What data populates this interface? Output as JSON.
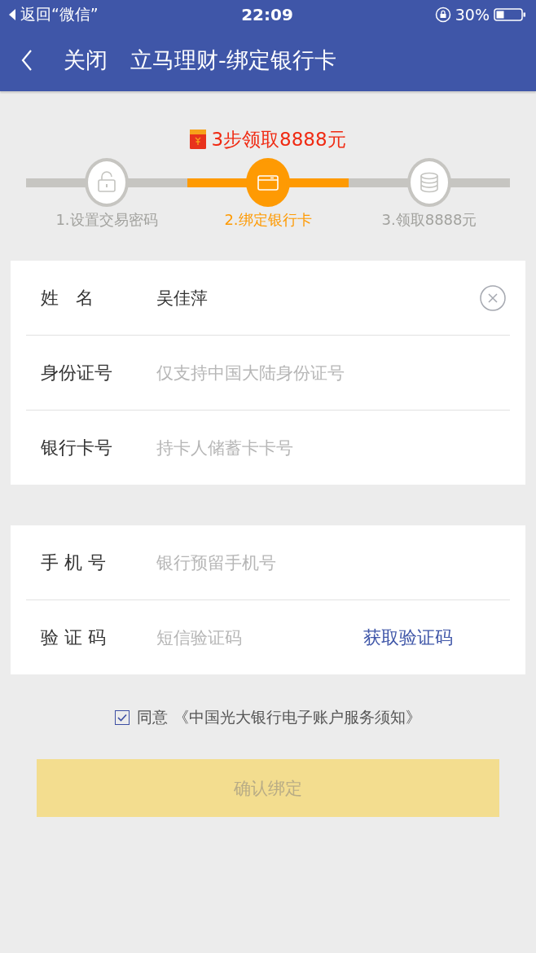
{
  "status_bar": {
    "back_app": "返回“微信”",
    "time": "22:09",
    "battery": "30%"
  },
  "nav": {
    "close": "关闭",
    "title": "立马理财-绑定银行卡"
  },
  "promo": {
    "text": "3步领取8888元"
  },
  "steps": [
    {
      "label": "1.设置交易密码",
      "kind": "lock",
      "selected": false
    },
    {
      "label": "2.绑定银行卡",
      "kind": "card",
      "selected": true
    },
    {
      "label": "3.领取8888元",
      "kind": "coins",
      "selected": false
    }
  ],
  "groups": [
    {
      "fields": [
        {
          "label": "姓   名",
          "value": "吴佳萍",
          "kind": "clear"
        },
        {
          "label": "身份证号",
          "placeholder": "仅支持中国大陆身份证号",
          "kind": "plain"
        },
        {
          "label": "银行卡号",
          "placeholder": "持卡人储蓄卡卡号",
          "kind": "plain"
        }
      ]
    },
    {
      "fields": [
        {
          "label": "手 机 号",
          "placeholder": "银行预留手机号",
          "kind": "plain"
        },
        {
          "label": "验 证 码",
          "placeholder": "短信验证码",
          "kind": "sms",
          "action": "获取验证码"
        }
      ]
    }
  ],
  "agreement": {
    "checked": true,
    "text": "同意 《中国光大银行电子账户服务须知》"
  },
  "submit": {
    "label": "确认绑定",
    "disabled": true
  }
}
